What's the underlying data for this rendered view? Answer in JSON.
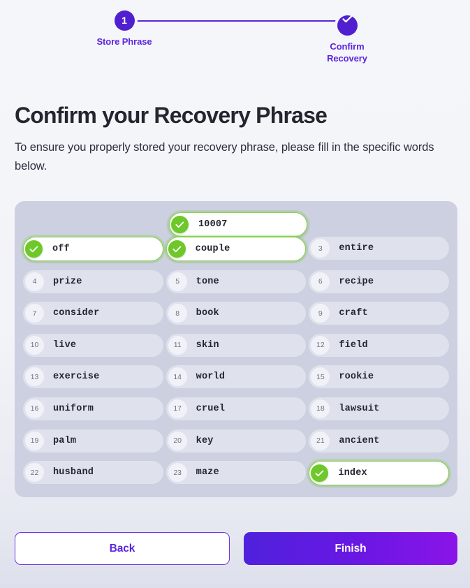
{
  "stepper": {
    "steps": [
      {
        "bullet": "1",
        "label": "Store Phrase",
        "state": "active"
      },
      {
        "bullet": "check-icon",
        "label": "Confirm Recovery",
        "state": "complete"
      }
    ],
    "accent_color": "#5020d0"
  },
  "heading": {
    "title": "Confirm your Recovery Phrase",
    "subtitle": "To ensure you properly stored your recovery phrase, please fill in the specific words below."
  },
  "floating_field": {
    "value": "10007",
    "status": "verified",
    "icon": "check-icon"
  },
  "grid": {
    "verified_color": "#6ec82a",
    "panel_color": "#ccd0e0",
    "cells": [
      {
        "index": "1",
        "word": "off",
        "filled": true
      },
      {
        "index": "2",
        "word": "couple",
        "filled": true
      },
      {
        "index": "3",
        "word": "entire",
        "filled": false
      },
      {
        "index": "4",
        "word": "prize",
        "filled": false
      },
      {
        "index": "5",
        "word": "tone",
        "filled": false
      },
      {
        "index": "6",
        "word": "recipe",
        "filled": false
      },
      {
        "index": "7",
        "word": "consider",
        "filled": false
      },
      {
        "index": "8",
        "word": "book",
        "filled": false
      },
      {
        "index": "9",
        "word": "craft",
        "filled": false
      },
      {
        "index": "10",
        "word": "live",
        "filled": false
      },
      {
        "index": "11",
        "word": "skin",
        "filled": false
      },
      {
        "index": "12",
        "word": "field",
        "filled": false
      },
      {
        "index": "13",
        "word": "exercise",
        "filled": false
      },
      {
        "index": "14",
        "word": "world",
        "filled": false
      },
      {
        "index": "15",
        "word": "rookie",
        "filled": false
      },
      {
        "index": "16",
        "word": "uniform",
        "filled": false
      },
      {
        "index": "17",
        "word": "cruel",
        "filled": false
      },
      {
        "index": "18",
        "word": "lawsuit",
        "filled": false
      },
      {
        "index": "19",
        "word": "palm",
        "filled": false
      },
      {
        "index": "20",
        "word": "key",
        "filled": false
      },
      {
        "index": "21",
        "word": "ancient",
        "filled": false
      },
      {
        "index": "22",
        "word": "husband",
        "filled": false
      },
      {
        "index": "23",
        "word": "maze",
        "filled": false
      },
      {
        "index": "24",
        "word": "index",
        "filled": true
      }
    ]
  },
  "footer": {
    "back_label": "Back",
    "finish_label": "Finish",
    "finish_gradient_start": "#4f21dc",
    "finish_gradient_end": "#8b14e8"
  }
}
